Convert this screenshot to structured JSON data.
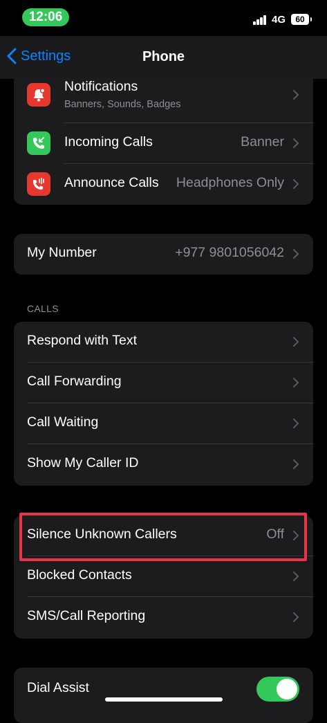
{
  "status_bar": {
    "time": "12:06",
    "network": "4G",
    "battery": "60"
  },
  "nav": {
    "back_label": "Settings",
    "title": "Phone"
  },
  "top_group": {
    "notifications": {
      "label": "Notifications",
      "subtitle": "Banners, Sounds, Badges",
      "icon": "bell-icon",
      "color": "#e5382e"
    },
    "incoming_calls": {
      "label": "Incoming Calls",
      "value": "Banner",
      "icon": "incoming-call-icon",
      "color": "#34c759"
    },
    "announce_calls": {
      "label": "Announce Calls",
      "value": "Headphones Only",
      "icon": "announce-call-icon",
      "color": "#e5382e"
    }
  },
  "my_number": {
    "label": "My Number",
    "value": "+977 9801056042"
  },
  "calls_section": {
    "header": "CALLS",
    "items": [
      {
        "label": "Respond with Text"
      },
      {
        "label": "Call Forwarding"
      },
      {
        "label": "Call Waiting"
      },
      {
        "label": "Show My Caller ID"
      }
    ]
  },
  "blocking_group": {
    "silence_unknown": {
      "label": "Silence Unknown Callers",
      "value": "Off"
    },
    "blocked_contacts": {
      "label": "Blocked Contacts"
    },
    "sms_reporting": {
      "label": "SMS/Call Reporting"
    }
  },
  "dial_assist": {
    "label": "Dial Assist",
    "enabled": true
  },
  "colors": {
    "accent": "#0a84ff",
    "toggle_on": "#34c759",
    "highlight": "#e8344b"
  }
}
